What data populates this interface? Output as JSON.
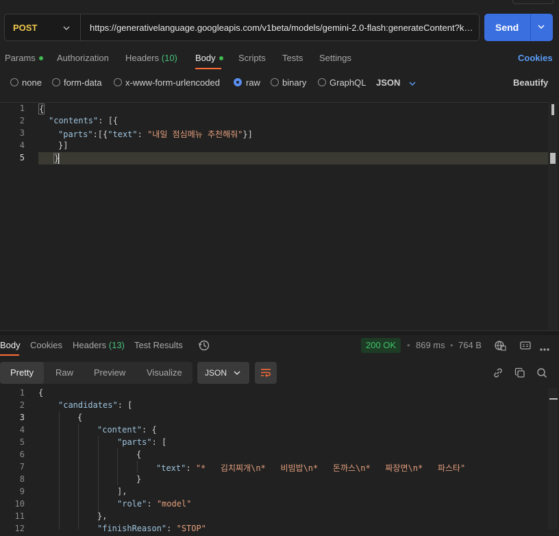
{
  "request": {
    "method": "POST",
    "url": "https://generativelanguage.googleapis.com/v1beta/models/gemini-2.0-flash:generateContent?key=",
    "send_label": "Send"
  },
  "tabs": {
    "params": "Params",
    "authorization": "Authorization",
    "headers": "Headers",
    "headers_count": "(10)",
    "body": "Body",
    "scripts": "Scripts",
    "tests": "Tests",
    "settings": "Settings",
    "cookies": "Cookies"
  },
  "body_types": {
    "none": "none",
    "form_data": "form-data",
    "urlencoded": "x-www-form-urlencoded",
    "raw": "raw",
    "binary": "binary",
    "graphql": "GraphQL",
    "format": "JSON",
    "beautify": "Beautify",
    "selected": "raw"
  },
  "editor": {
    "line_numbers": [
      "1",
      "2",
      "3",
      "4",
      "5"
    ],
    "line1": "{",
    "l2_key": "\"contents\"",
    "l2_rest": ": [{",
    "l3_key": "\"parts\"",
    "l3_mid": ":[{",
    "l3_key2": "\"text\"",
    "l3_colon": ": ",
    "l3_str": "\"내일 점심메뉴 추천해줘\"",
    "l3_end": "}]",
    "line4": "}]",
    "line5": "}"
  },
  "response": {
    "tabs": {
      "body": "Body",
      "cookies": "Cookies",
      "headers": "Headers",
      "headers_count": "(13)",
      "test_results": "Test Results"
    },
    "status": "200 OK",
    "time": "869 ms",
    "size": "764 B",
    "views": {
      "pretty": "Pretty",
      "raw": "Raw",
      "preview": "Preview",
      "visualize": "Visualize"
    },
    "format": "JSON",
    "line_numbers": [
      "1",
      "2",
      "3",
      "4",
      "5",
      "6",
      "7",
      "8",
      "9",
      "10",
      "11",
      "12"
    ],
    "r1": "{",
    "r2_key": "\"candidates\"",
    "r2_rest": ": [",
    "r3": "{",
    "r4_key": "\"content\"",
    "r4_rest": ": {",
    "r5_key": "\"parts\"",
    "r5_rest": ": [",
    "r6": "{",
    "r7_key": "\"text\"",
    "r7_colon": ": ",
    "r7_str": "\"*   김치찌개\\n*   비빔밥\\n*   돈까스\\n*   짜장면\\n*   파스타\"",
    "r8": "}",
    "r9": "],",
    "r10_key": "\"role\"",
    "r10_colon": ": ",
    "r10_str": "\"model\"",
    "r11": "},",
    "r12_key": "\"finishReason\"",
    "r12_colon": ": ",
    "r12_str": "\"STOP\""
  },
  "icons": {
    "method_dropdown": "chevron-down-icon",
    "send_dropdown": "chevron-down-icon",
    "history": "history-icon",
    "save_response": "globe-save-icon",
    "example": "example-icon",
    "more": "more-horizontal-icon",
    "copy_link": "link-icon",
    "copy": "copy-icon",
    "search": "search-icon",
    "wrap": "wrap-lines-icon"
  },
  "colors": {
    "method": "#f2c94c",
    "send": "#3a6fe0",
    "status_ok": "#3fc56b",
    "accent_tab": "#ff6c37",
    "link": "#5a9cf8"
  }
}
